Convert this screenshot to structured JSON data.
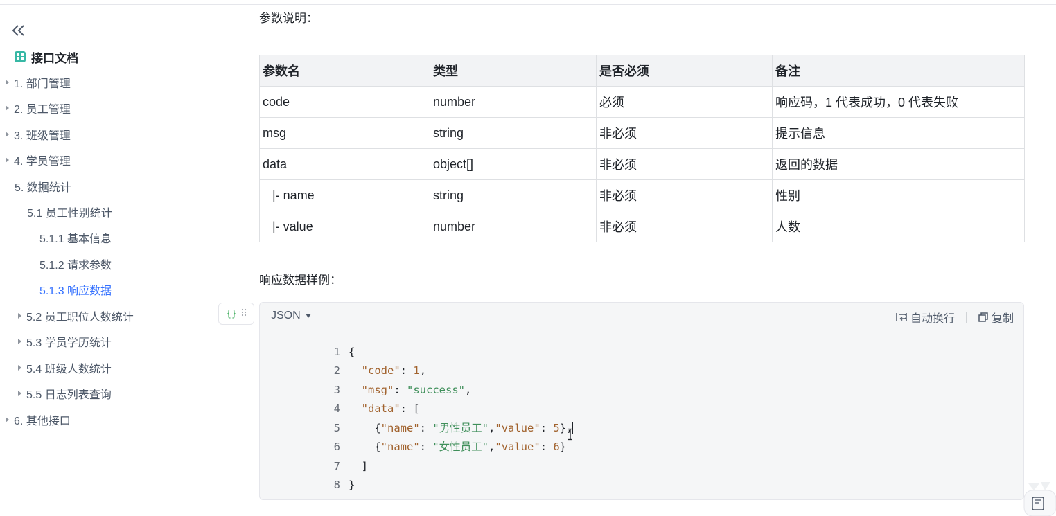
{
  "sidebar": {
    "doc_title": "接口文档",
    "items": [
      {
        "label": "1. 部门管理"
      },
      {
        "label": "2. 员工管理"
      },
      {
        "label": "3. 班级管理"
      },
      {
        "label": "4. 学员管理"
      },
      {
        "label": "5. 数据统计"
      },
      {
        "label": "5.1 员工性别统计"
      },
      {
        "label": "5.1.1 基本信息"
      },
      {
        "label": "5.1.2 请求参数"
      },
      {
        "label": "5.1.3 响应数据",
        "active": true
      },
      {
        "label": "5.2 员工职位人数统计"
      },
      {
        "label": "5.3 学员学历统计"
      },
      {
        "label": "5.4 班级人数统计"
      },
      {
        "label": "5.5 日志列表查询"
      },
      {
        "label": "6. 其他接口"
      }
    ]
  },
  "content": {
    "param_heading": "参数说明：",
    "table": {
      "headers": [
        "参数名",
        "类型",
        "是否必须",
        "备注"
      ],
      "rows": [
        [
          "code",
          "number",
          "必须",
          "响应码，1 代表成功，0 代表失败"
        ],
        [
          "msg",
          "string",
          "非必须",
          "提示信息"
        ],
        [
          "data",
          "object[]",
          "非必须",
          "返回的数据"
        ],
        [
          "|- name",
          "string",
          "非必须",
          "性别"
        ],
        [
          "|- value",
          "number",
          "非必须",
          "人数"
        ]
      ]
    },
    "sample_heading": "响应数据样例：",
    "code": {
      "handle_label": "{}",
      "language": "JSON",
      "wrap_label": "自动换行",
      "copy_label": "复制",
      "lines": {
        "l1": {
          "no": "1",
          "t1": "{"
        },
        "l2": {
          "no": "2",
          "k": "\"code\"",
          "p1": ": ",
          "v": "1",
          "p2": ","
        },
        "l3": {
          "no": "3",
          "k": "\"msg\"",
          "p1": ": ",
          "v": "\"success\"",
          "p2": ","
        },
        "l4": {
          "no": "4",
          "k": "\"data\"",
          "p1": ": ["
        },
        "l5": {
          "no": "5",
          "p0": "{",
          "k1": "\"name\"",
          "p1": ": ",
          "v1": "\"男性员工\"",
          "p2": ",",
          "k2": "\"value\"",
          "p3": ": ",
          "v2": "5",
          "p4": "},"
        },
        "l6": {
          "no": "6",
          "p0": "{",
          "k1": "\"name\"",
          "p1": ": ",
          "v1": "\"女性员工\"",
          "p2": ",",
          "k2": "\"value\"",
          "p3": ": ",
          "v2": "6",
          "p4": "}"
        },
        "l7": {
          "no": "7",
          "t1": "]"
        },
        "l8": {
          "no": "8",
          "t1": "}"
        }
      }
    }
  },
  "colors": {
    "active_link": "#3370ff",
    "json_key": "#a1622d",
    "json_string": "#3f8f5a",
    "code_bg": "#f5f6f7",
    "table_header_bg": "#f2f3f5",
    "doc_icon": "#37b8a5"
  }
}
